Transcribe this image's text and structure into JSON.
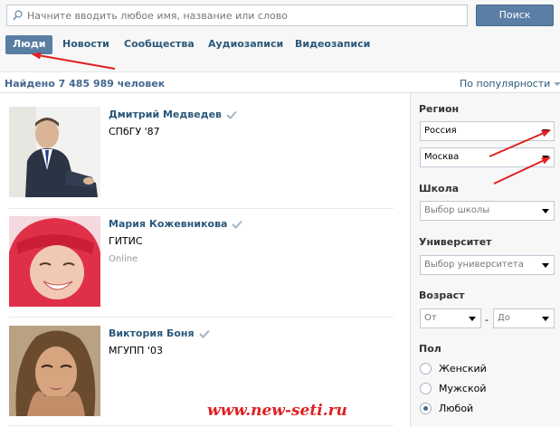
{
  "search": {
    "placeholder": "Начните вводить любое имя, название или слово",
    "button_label": "Поиск"
  },
  "tabs": [
    {
      "label": "Люди",
      "active": true
    },
    {
      "label": "Новости",
      "active": false
    },
    {
      "label": "Сообщества",
      "active": false
    },
    {
      "label": "Аудиозаписи",
      "active": false
    },
    {
      "label": "Видеозаписи",
      "active": false
    }
  ],
  "results": {
    "count_text": "Найдено 7 485 989 человек",
    "sort_label": "По популярности"
  },
  "people": [
    {
      "name": "Дмитрий Медведев",
      "info": "СПбГУ '87",
      "status": ""
    },
    {
      "name": "Мария Кожевникова",
      "info": "ГИТИС",
      "status": "Online"
    },
    {
      "name": "Виктория Боня",
      "info": "МГУПП '03",
      "status": ""
    }
  ],
  "filters": {
    "region_label": "Регион",
    "country_value": "Россия",
    "city_value": "Москва",
    "school_label": "Школа",
    "school_placeholder": "Выбор школы",
    "university_label": "Университет",
    "university_placeholder": "Выбор университета",
    "age_label": "Возраст",
    "age_from": "От",
    "age_to": "До",
    "age_dash": "-",
    "gender_label": "Пол",
    "gender_options": [
      {
        "label": "Женский",
        "checked": false
      },
      {
        "label": "Мужской",
        "checked": false
      },
      {
        "label": "Любой",
        "checked": true
      }
    ]
  },
  "watermark": "www.new-seti.ru",
  "colors": {
    "accent": "#597da3",
    "link": "#2b587a",
    "annotation": "#e02020"
  }
}
